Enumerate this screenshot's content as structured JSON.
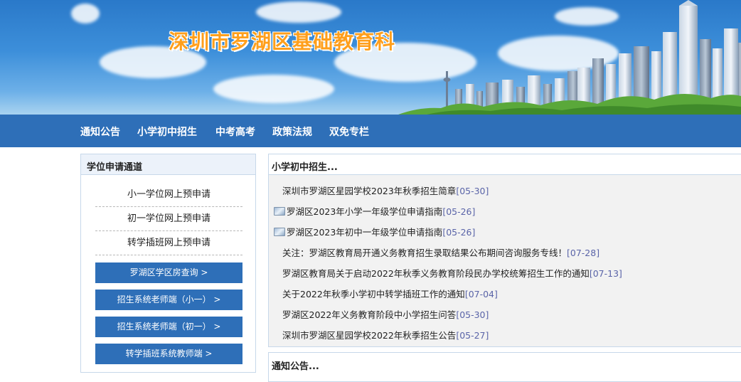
{
  "site": {
    "title": "深圳市罗湖区基础教育科"
  },
  "nav": {
    "items": [
      "通知公告",
      "小学初中招生",
      "中考高考",
      "政策法规",
      "双免专栏"
    ]
  },
  "left_panel": {
    "title": "学位申请通道",
    "links": [
      "小一学位网上预申请",
      "初一学位网上预申请",
      "转学插班网上预申请"
    ],
    "buttons": [
      "罗湖区学区房查询 >",
      "招生系统老师端（小一） >",
      "招生系统老师端（初一） >",
      "转学插班系统教师端 >"
    ]
  },
  "enrollment": {
    "title": "小学初中招生...",
    "items": [
      {
        "title": "深圳市罗湖区星园学校2023年秋季招生简章",
        "date": "[05-30]",
        "icon": false
      },
      {
        "title": "罗湖区2023年小学一年级学位申请指南",
        "date": "[05-26]",
        "icon": true
      },
      {
        "title": "罗湖区2023年初中一年级学位申请指南",
        "date": "[05-26]",
        "icon": true
      },
      {
        "title": "关注：罗湖区教育局开通义务教育招生录取结果公布期间咨询服务专线！",
        "date": "[07-28]",
        "icon": false
      },
      {
        "title": "罗湖区教育局关于启动2022年秋季义务教育阶段民办学校统筹招生工作的通知",
        "date": "[07-13]",
        "icon": false
      },
      {
        "title": "关于2022年秋季小学初中转学插班工作的通知",
        "date": "[07-04]",
        "icon": false
      },
      {
        "title": "罗湖区2022年义务教育阶段中小学招生问答",
        "date": "[05-30]",
        "icon": false
      },
      {
        "title": "深圳市罗湖区星园学校2022年秋季招生公告",
        "date": "[05-27]",
        "icon": false
      }
    ]
  },
  "notices": {
    "title": "通知公告..."
  },
  "colors": {
    "nav_bg": "#2e6fb8",
    "title_orange": "#ff9f1c",
    "date_blue": "#5a64a8"
  }
}
